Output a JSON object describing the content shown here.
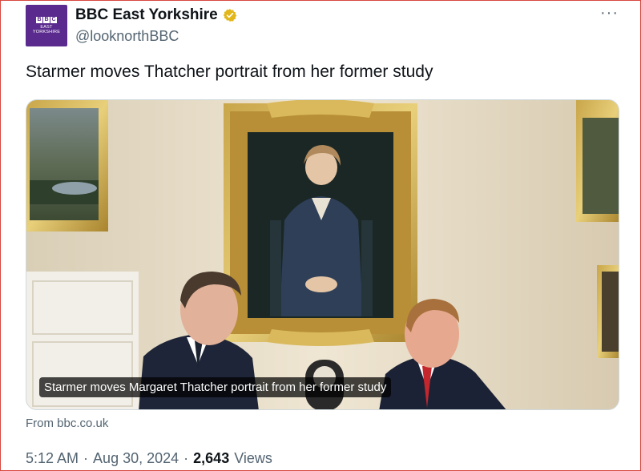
{
  "account": {
    "display_name": "BBC East Yorkshire",
    "handle": "@looknorthBBC",
    "avatar_letters": [
      "B",
      "B",
      "C"
    ],
    "avatar_subtitle_line1": "EAST",
    "avatar_subtitle_line2": "YORKSHIRE",
    "verified": true,
    "verified_color": "#e2b719",
    "avatar_color": "#5a2a8e"
  },
  "more_menu": {
    "label": "···",
    "icon": "more-icon"
  },
  "tweet": {
    "text": "Starmer moves Thatcher portrait from her former study"
  },
  "media": {
    "caption": "Starmer moves Margaret Thatcher portrait from her former study",
    "source": "From bbc.co.uk"
  },
  "meta": {
    "time": "5:12 AM",
    "separator1": "·",
    "date": "Aug 30, 2024",
    "separator2": "·",
    "views_count": "2,643",
    "views_label": "Views"
  },
  "colors": {
    "text_primary": "#0f1419",
    "text_secondary": "#536471",
    "border": "#cfd9de",
    "frame": "#d8463f"
  }
}
